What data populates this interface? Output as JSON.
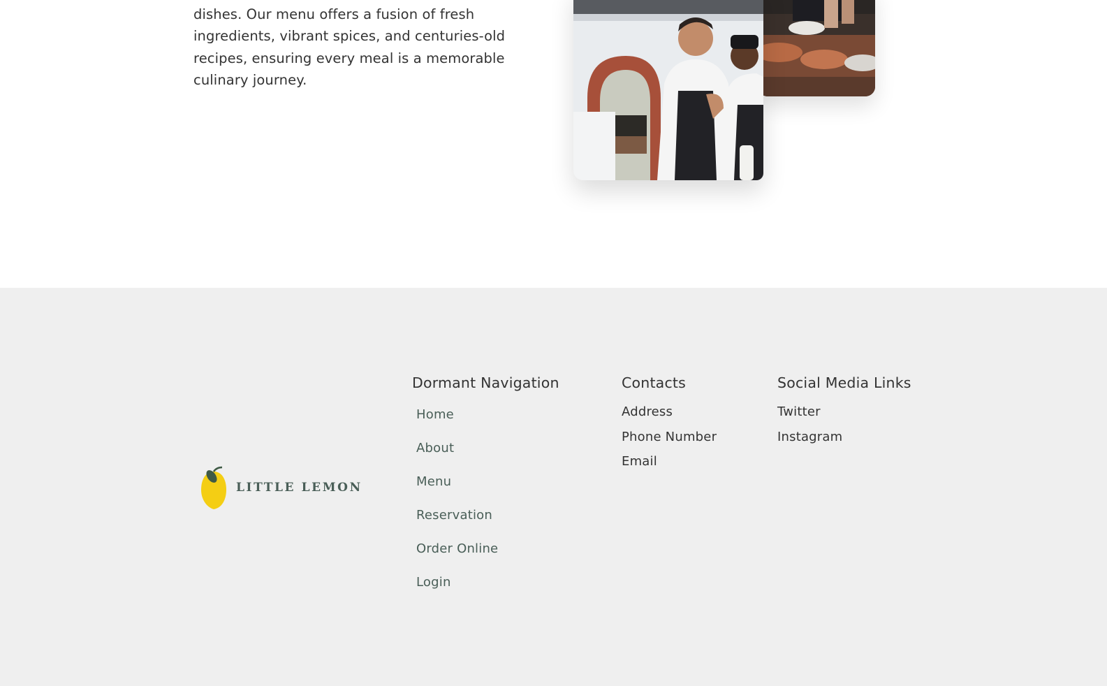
{
  "about": {
    "paragraph": "passion for crafting authentic and exquisite dishes. Our menu offers a fusion of fresh ingredients, vibrant spices, and centuries-old recipes, ensuring every meal is a memorable culinary journey."
  },
  "footer": {
    "logo": {
      "text": "LITTLE LEMON"
    },
    "navigation": {
      "heading": "Dormant Navigation",
      "items": [
        "Home",
        "About",
        "Menu",
        "Reservation",
        "Order Online",
        "Login"
      ]
    },
    "contacts": {
      "heading": "Contacts",
      "items": [
        "Address",
        "Phone Number",
        "Email"
      ]
    },
    "social": {
      "heading": "Social Media Links",
      "items": [
        "Twitter",
        "Instagram"
      ]
    }
  },
  "colors": {
    "footer_bg": "#efefef",
    "brand_green": "#495e57",
    "brand_yellow": "#f4ce14",
    "text": "#333333"
  }
}
